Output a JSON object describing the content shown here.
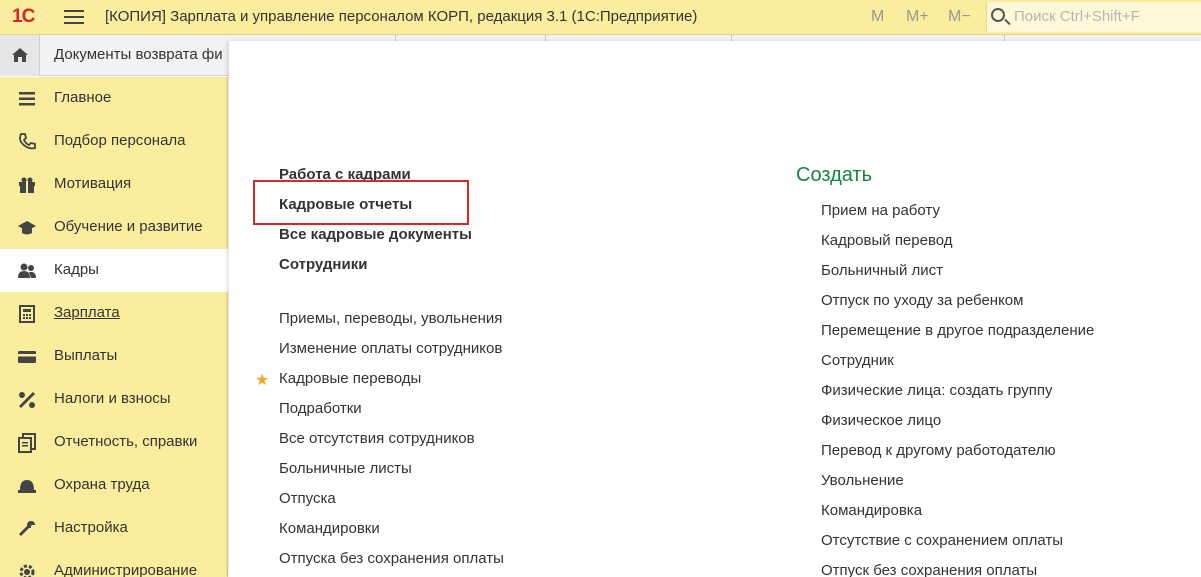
{
  "app": {
    "logo": "1С",
    "title": "[КОПИЯ] Зарплата и управление персоналом КОРП, редакция 3.1  (1С:Предприятие)",
    "buttons": {
      "m": "M",
      "m_plus": "M+",
      "m_minus": "M−"
    },
    "search_placeholder": "Поиск Ctrl+Shift+F"
  },
  "tabs": {
    "open_tab": "Документы возврата фи"
  },
  "sidebar": {
    "items": [
      {
        "label": "Главное",
        "icon": "list-icon"
      },
      {
        "label": "Подбор персонала",
        "icon": "phone-icon"
      },
      {
        "label": "Мотивация",
        "icon": "gift-icon"
      },
      {
        "label": "Обучение и развитие",
        "icon": "graduation-cap-icon"
      },
      {
        "label": "Кадры",
        "icon": "people-icon",
        "active": true
      },
      {
        "label": "Зарплата",
        "icon": "calculator-icon",
        "underlined": true
      },
      {
        "label": "Выплаты",
        "icon": "card-icon"
      },
      {
        "label": "Налоги и взносы",
        "icon": "percent-icon"
      },
      {
        "label": "Отчетность, справки",
        "icon": "report-icon"
      },
      {
        "label": "Охрана труда",
        "icon": "helmet-icon"
      },
      {
        "label": "Настройка",
        "icon": "wrench-icon"
      },
      {
        "label": "Администрирование",
        "icon": "gear-icon"
      }
    ]
  },
  "main": {
    "sections": [
      "Работа с кадрами",
      "Кадровые отчеты",
      "Все кадровые документы",
      "Сотрудники"
    ],
    "links": [
      "Приемы, переводы, увольнения",
      "Изменение оплаты сотрудников",
      "Кадровые переводы",
      "Подработки",
      "Все отсутствия сотрудников",
      "Больничные листы",
      "Отпуска",
      "Командировки",
      "Отпуска без сохранения оплаты"
    ],
    "star": "★",
    "create": {
      "title": "Создать",
      "items": [
        "Прием на работу",
        "Кадровый перевод",
        "Больничный лист",
        "Отпуск по уходу за ребенком",
        "Перемещение в другое подразделение",
        "Сотрудник",
        "Физические лица: создать группу",
        "Физическое лицо",
        "Перевод к другому работодателю",
        "Увольнение",
        "Командировка",
        "Отсутствие с сохранением оплаты",
        "Отпуск без сохранения оплаты"
      ]
    }
  },
  "colors": {
    "sidebar_bg": "#fbed9e",
    "accent_green": "#15843f",
    "highlight_red": "#d42a2a",
    "favorite_star": "#f5a623"
  }
}
